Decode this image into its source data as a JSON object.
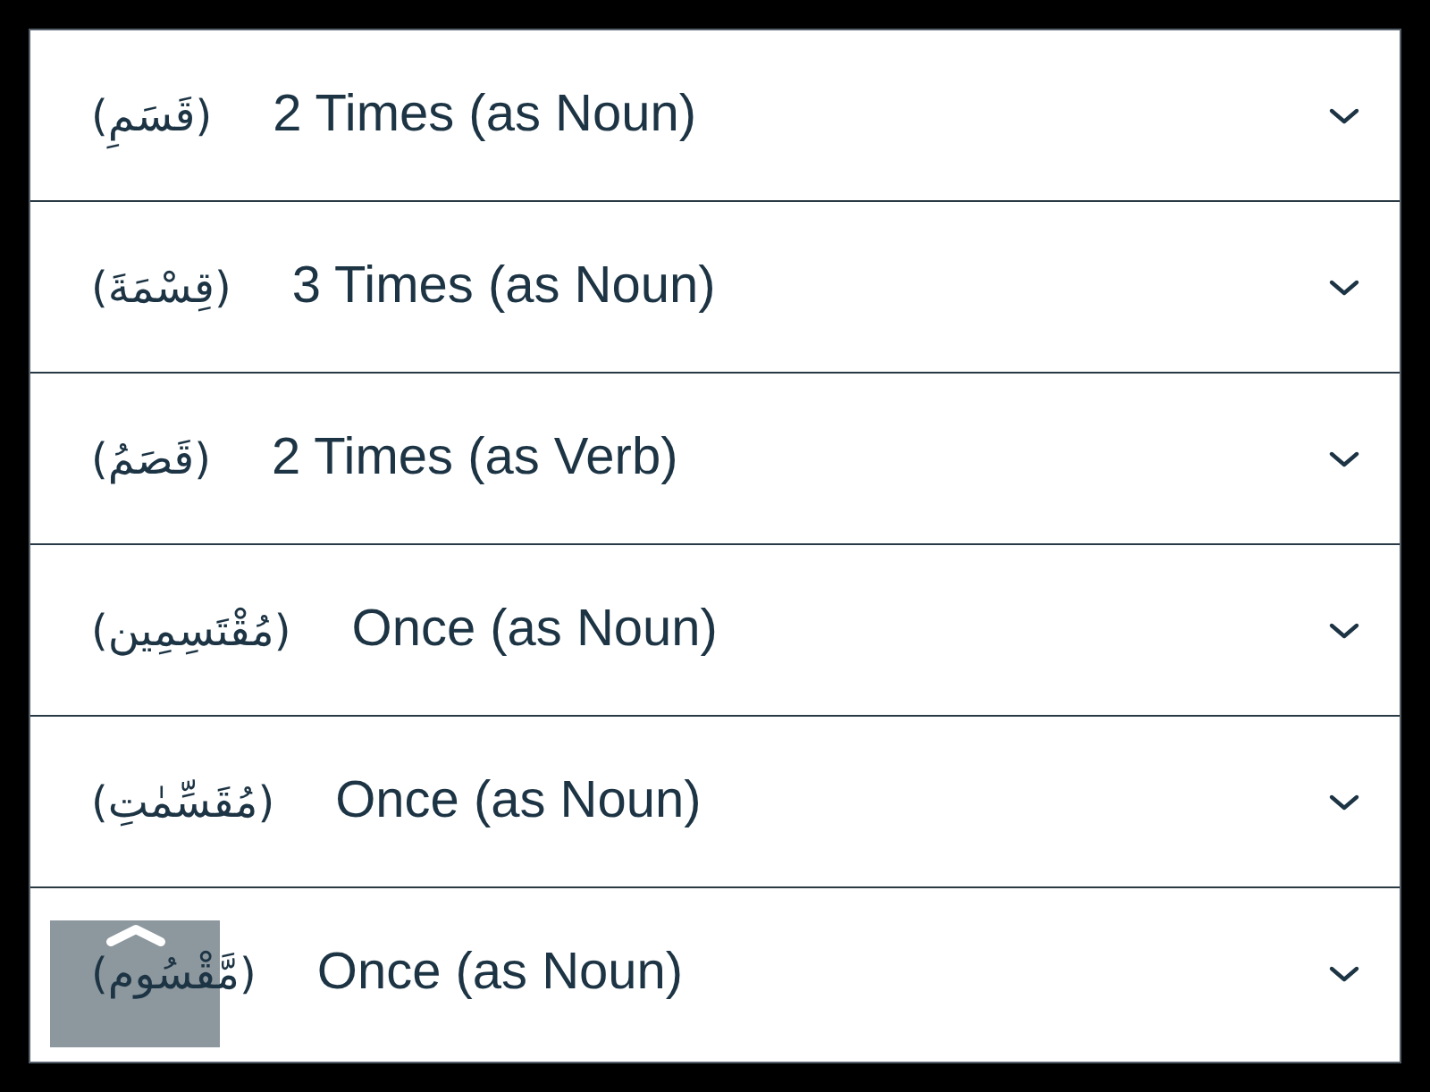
{
  "items": [
    {
      "arabic": "(قَسَمِ)",
      "label": "2 Times (as Noun)",
      "expanded": false
    },
    {
      "arabic": "(قِسْمَةَ)",
      "label": "3 Times (as Noun)",
      "expanded": false
    },
    {
      "arabic": "(قَصَمُ)",
      "label": "2 Times (as Verb)",
      "expanded": false
    },
    {
      "arabic": "(مُقْتَسِمِين)",
      "label": "Once (as Noun)",
      "expanded": false
    },
    {
      "arabic": "(مُقَسِّمٰتِ)",
      "label": "Once (as Noun)",
      "expanded": false
    },
    {
      "arabic": "(مَّقْسُوم)",
      "label": "Once (as Noun)",
      "expanded": false
    }
  ]
}
